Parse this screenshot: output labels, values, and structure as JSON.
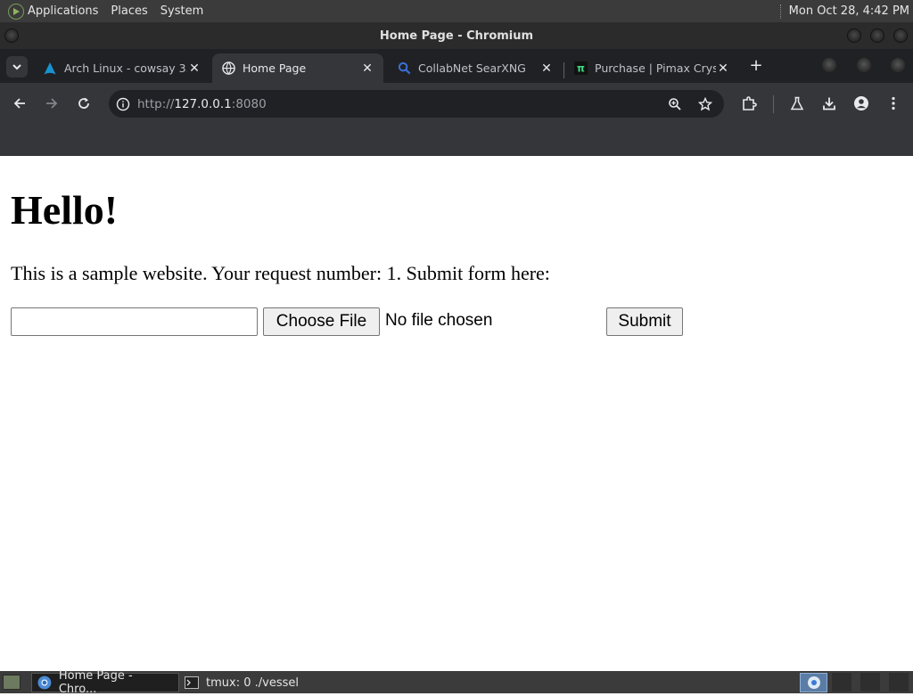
{
  "top_panel": {
    "menus": [
      "Applications",
      "Places",
      "System"
    ],
    "clock": "Mon Oct 28,  4:42 PM"
  },
  "window": {
    "title": "Home Page - Chromium"
  },
  "tabs": [
    {
      "label": "Arch Linux - cowsay 3.",
      "icon": "arch-linux-icon",
      "active": false
    },
    {
      "label": "Home Page",
      "icon": "globe-icon",
      "active": true
    },
    {
      "label": "CollabNet SearXNG",
      "icon": "search-icon",
      "active": false
    },
    {
      "label": "Purchase | Pimax Crys",
      "icon": "pimax-icon",
      "active": false
    }
  ],
  "address_bar": {
    "scheme": "http://",
    "host": "127.0.0.1",
    "port": ":8080"
  },
  "page": {
    "heading": "Hello!",
    "intro": "This is a sample website. Your request number: 1. Submit form here:",
    "text_input_value": "",
    "file_button_label": "Choose File",
    "file_status": "No file chosen",
    "submit_label": "Submit"
  },
  "taskbar": {
    "tasks": [
      {
        "label": "Home Page - Chro...",
        "icon": "chromium-icon",
        "active": true
      },
      {
        "label": "tmux: 0 ./vessel",
        "icon": "terminal-icon",
        "active": false
      }
    ]
  },
  "colors": {
    "panel_bg": "#3b3b3b",
    "tabstrip_bg": "#202124",
    "toolbar_bg": "#35363a",
    "omnibox_bg": "#202124"
  }
}
